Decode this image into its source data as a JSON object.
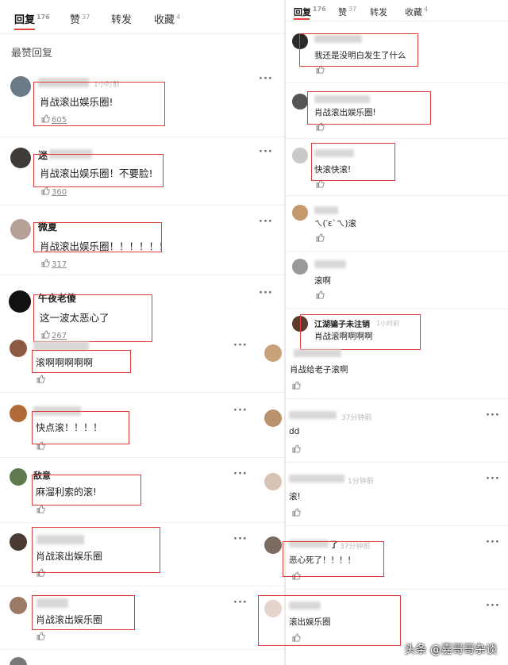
{
  "left": {
    "tabs": [
      {
        "label": "回复",
        "count": "176"
      },
      {
        "label": "赞",
        "count": "37"
      },
      {
        "label": "转发",
        "count": ""
      },
      {
        "label": "收藏",
        "count": "4"
      }
    ],
    "section_title": "最赞回复",
    "comments": [
      {
        "name": "",
        "time": "1小时前",
        "text": "肖战滚出娱乐圈!",
        "likes": "605"
      },
      {
        "name": "迷",
        "time": "",
        "text": "肖战滚出娱乐圈！不要脸!",
        "likes": "360"
      },
      {
        "name": "微夏",
        "time": "",
        "text": "肖战滚出娱乐圈！！！！！！",
        "likes": "317"
      },
      {
        "name": "午夜老傻",
        "time": "",
        "text": "这一波太恶心了",
        "likes": "267"
      },
      {
        "name": "",
        "time": "",
        "text": "滚啊啊啊啊啊",
        "likes": ""
      },
      {
        "name": "",
        "time": "",
        "text": "快点滚！！！！",
        "likes": ""
      },
      {
        "name": "敌意",
        "time": "",
        "text": "麻溜利索的滚!",
        "likes": ""
      },
      {
        "name": "",
        "time": "",
        "text": "肖战滚出娱乐圈",
        "likes": ""
      },
      {
        "name": "",
        "time": "",
        "text": "肖战滚出娱乐圈",
        "likes": ""
      }
    ]
  },
  "right": {
    "tabs": [
      {
        "label": "回复",
        "count": "176"
      },
      {
        "label": "赞",
        "count": "37"
      },
      {
        "label": "转发",
        "count": ""
      },
      {
        "label": "收藏",
        "count": "4"
      }
    ],
    "comments": [
      {
        "name": "",
        "time": "",
        "text": "我还是没明白发生了什么"
      },
      {
        "name": "",
        "time": "",
        "text": "肖战滚出娱乐圈!"
      },
      {
        "name": "",
        "time": "",
        "text": "快滚快滚!"
      },
      {
        "name": "",
        "time": "",
        "text": "ㄟ(′ε`ㄟ)滚"
      },
      {
        "name": "",
        "time": "",
        "text": "滚啊"
      },
      {
        "name": "江湖骗子未注销",
        "time": "1小时前",
        "text": "肖战滚啊啊啊啊"
      },
      {
        "name": "",
        "time": "",
        "text": "肖战给老子滚啊"
      },
      {
        "name": "",
        "time": "37分钟前",
        "text": "dd"
      },
      {
        "name": "",
        "time": "1分钟前",
        "text": "滚!"
      },
      {
        "name": "了",
        "time": "37分钟前",
        "text": "恶心死了！！！！"
      },
      {
        "name": "",
        "time": "",
        "text": "滚出娱乐圈"
      }
    ]
  },
  "watermark": "头条 @嘉哥哥杂谈",
  "colors": {
    "highlight_box": "#e23d3d",
    "tab_underline": "#e0463b"
  }
}
